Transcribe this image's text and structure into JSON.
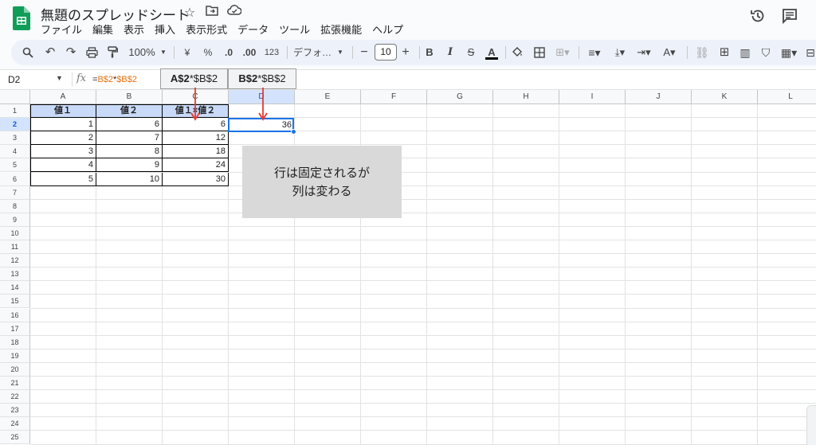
{
  "header": {
    "doc_title": "無題のスプレッドシート",
    "title_icons": [
      "star-icon",
      "move-folder-icon",
      "cloud-status-icon"
    ],
    "right_icons": [
      "history-icon",
      "comment-icon"
    ]
  },
  "menu": [
    "ファイル",
    "編集",
    "表示",
    "挿入",
    "表示形式",
    "データ",
    "ツール",
    "拡張機能",
    "ヘルプ"
  ],
  "toolbar": {
    "zoom": "100%",
    "currency": "¥",
    "percent": "%",
    "dec_decrease": ".0",
    "dec_increase": ".00",
    "number_format": "123",
    "font": "デフォ…",
    "font_size": "10",
    "bold": "B",
    "italic": "I",
    "strike": "S",
    "text_color": "A"
  },
  "formula_bar": {
    "name_box": "D2",
    "fx": "fx",
    "formula_prefix": "=",
    "formula_ref1": "B$2",
    "formula_op": "*",
    "formula_ref2": "$B$2"
  },
  "callouts": [
    {
      "ref": "A$2",
      "rest": "*$B$2"
    },
    {
      "ref": "B$2",
      "rest": "*$B$2"
    }
  ],
  "columns": [
    "A",
    "B",
    "C",
    "D",
    "E",
    "F",
    "G",
    "H",
    "I",
    "J",
    "K",
    "L"
  ],
  "selected_column": "D",
  "selected_row": "2",
  "rows": [
    "1",
    "2",
    "3",
    "4",
    "5",
    "6",
    "7",
    "8",
    "9",
    "10",
    "11",
    "12",
    "13",
    "14",
    "15",
    "16",
    "17",
    "18",
    "19",
    "20",
    "21",
    "22",
    "23",
    "24",
    "25"
  ],
  "table": {
    "headers": [
      "値１",
      "値２",
      "値１×値２"
    ],
    "data": [
      [
        "1",
        "6",
        "6"
      ],
      [
        "2",
        "7",
        "12"
      ],
      [
        "3",
        "8",
        "18"
      ],
      [
        "4",
        "9",
        "24"
      ],
      [
        "5",
        "10",
        "30"
      ]
    ]
  },
  "d2_value": "36",
  "note": {
    "line1": "行は固定されるが",
    "line2": "列は変わる"
  },
  "colors": {
    "accent": "#1a73e8",
    "header_fill": "#c9daf8",
    "arrow": "#e53935",
    "formula_ref": "#e8710a"
  }
}
